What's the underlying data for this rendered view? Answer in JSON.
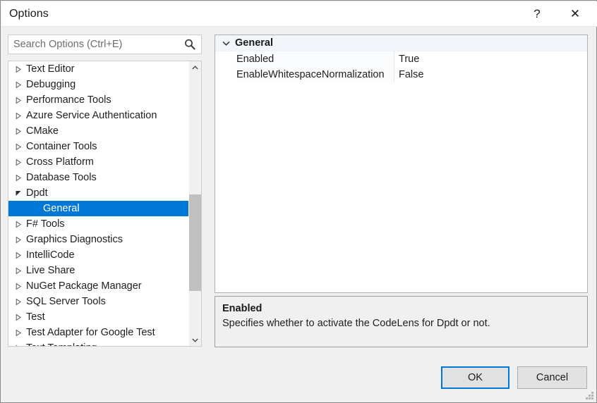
{
  "window": {
    "title": "Options",
    "help_glyph": "?",
    "close_glyph": "✕"
  },
  "search": {
    "placeholder": "Search Options (Ctrl+E)",
    "value": "",
    "icon": "search-icon"
  },
  "tree": {
    "items": [
      {
        "label": "Text Editor",
        "level": 0,
        "expanded": false,
        "selected": false
      },
      {
        "label": "Debugging",
        "level": 0,
        "expanded": false,
        "selected": false
      },
      {
        "label": "Performance Tools",
        "level": 0,
        "expanded": false,
        "selected": false
      },
      {
        "label": "Azure Service Authentication",
        "level": 0,
        "expanded": false,
        "selected": false
      },
      {
        "label": "CMake",
        "level": 0,
        "expanded": false,
        "selected": false
      },
      {
        "label": "Container Tools",
        "level": 0,
        "expanded": false,
        "selected": false
      },
      {
        "label": "Cross Platform",
        "level": 0,
        "expanded": false,
        "selected": false
      },
      {
        "label": "Database Tools",
        "level": 0,
        "expanded": false,
        "selected": false
      },
      {
        "label": "Dpdt",
        "level": 0,
        "expanded": true,
        "selected": false
      },
      {
        "label": "General",
        "level": 1,
        "expanded": false,
        "selected": true
      },
      {
        "label": "F# Tools",
        "level": 0,
        "expanded": false,
        "selected": false
      },
      {
        "label": "Graphics Diagnostics",
        "level": 0,
        "expanded": false,
        "selected": false
      },
      {
        "label": "IntelliCode",
        "level": 0,
        "expanded": false,
        "selected": false
      },
      {
        "label": "Live Share",
        "level": 0,
        "expanded": false,
        "selected": false
      },
      {
        "label": "NuGet Package Manager",
        "level": 0,
        "expanded": false,
        "selected": false
      },
      {
        "label": "SQL Server Tools",
        "level": 0,
        "expanded": false,
        "selected": false
      },
      {
        "label": "Test",
        "level": 0,
        "expanded": false,
        "selected": false
      },
      {
        "label": "Test Adapter for Google Test",
        "level": 0,
        "expanded": false,
        "selected": false
      },
      {
        "label": "Text Templating",
        "level": 0,
        "expanded": false,
        "selected": false
      }
    ],
    "scrollbar": {
      "up_arrow": "chevron-up-icon",
      "down_arrow": "chevron-down-icon"
    }
  },
  "property_grid": {
    "category": {
      "label": "General",
      "expanded": true
    },
    "properties": [
      {
        "name": "Enabled",
        "value": "True"
      },
      {
        "name": "EnableWhitespaceNormalization",
        "value": "False"
      }
    ]
  },
  "description": {
    "title": "Enabled",
    "text": "Specifies whether to activate the CodeLens for Dpdt or not."
  },
  "footer": {
    "ok_label": "OK",
    "cancel_label": "Cancel"
  },
  "colors": {
    "accent": "#0078d7",
    "selection": "#0078d7",
    "dialog_bg": "#f0f0f0",
    "panel_bg": "#ffffff",
    "category_bg": "#f2f5fa",
    "button_bg": "#e1e1e1"
  }
}
